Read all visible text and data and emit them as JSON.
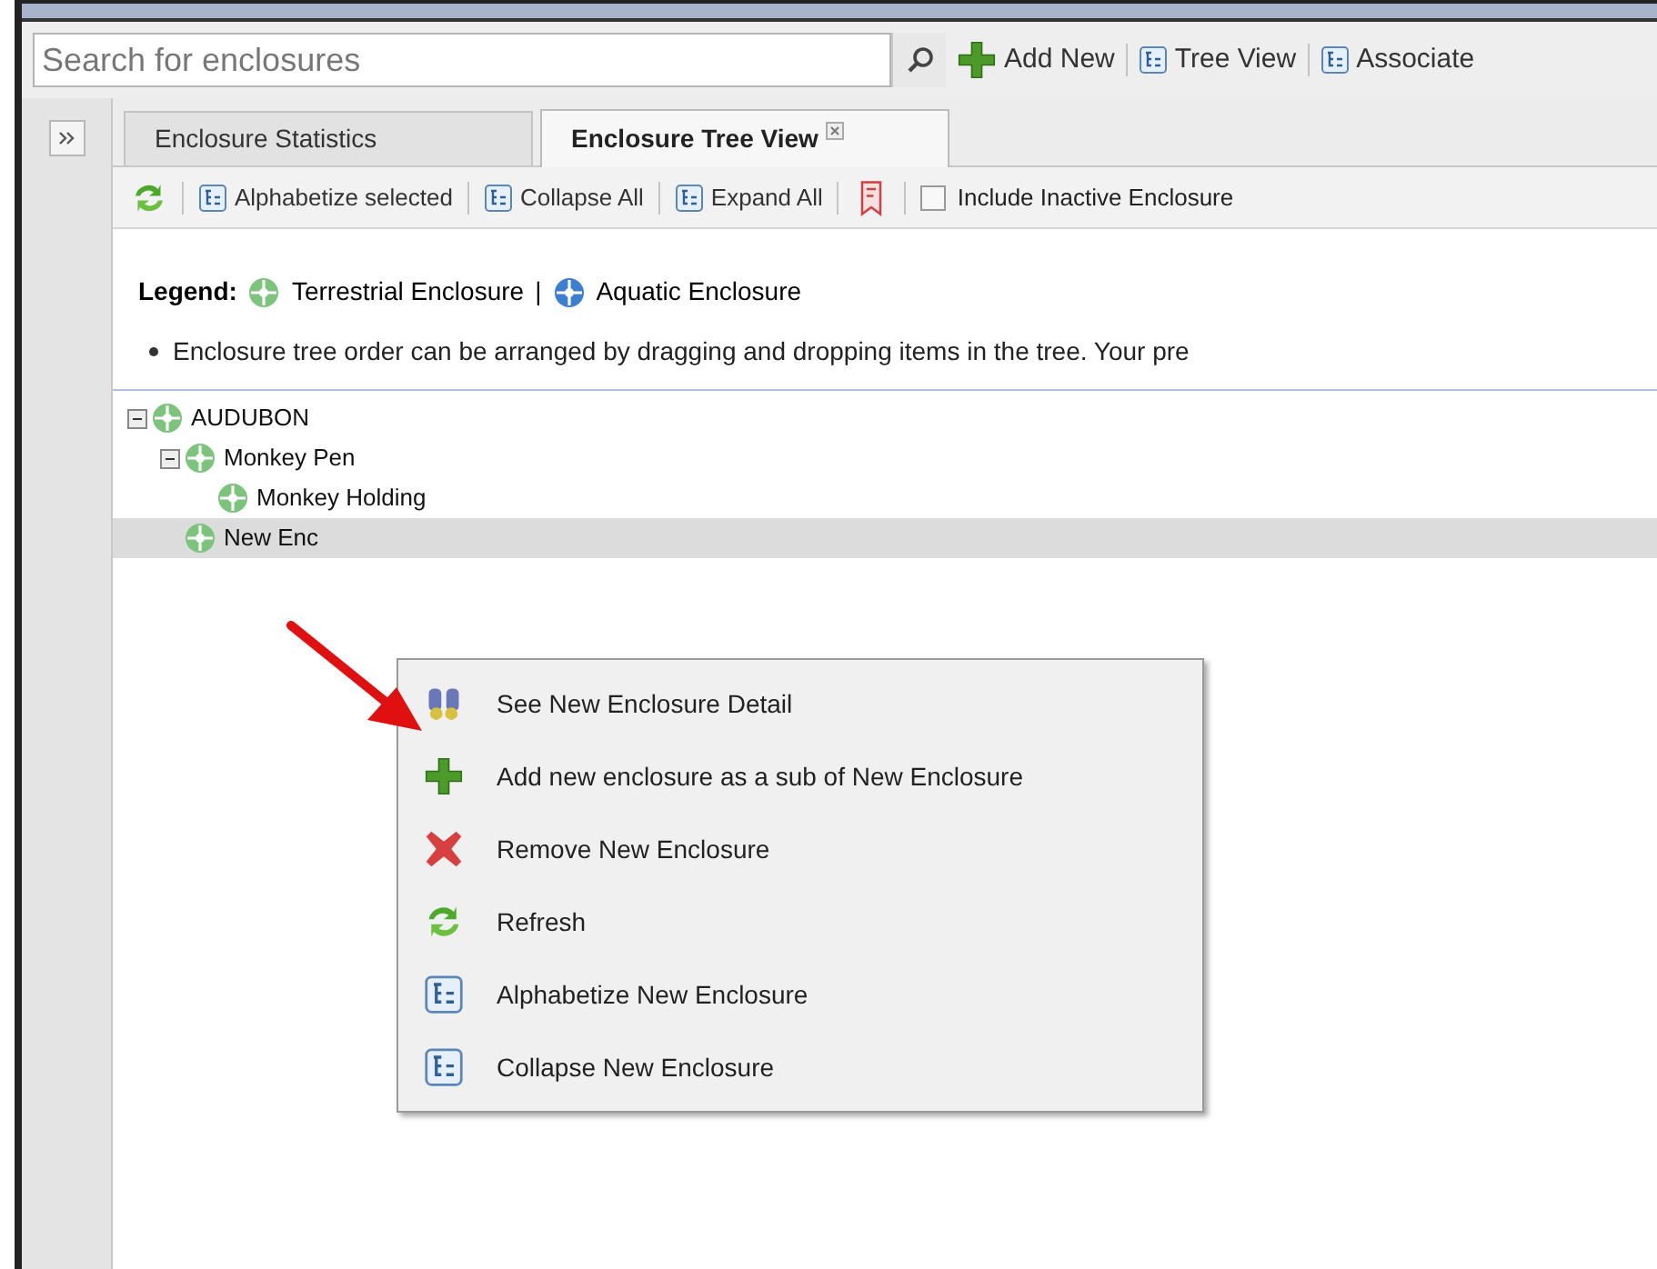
{
  "search": {
    "placeholder": "Search for enclosures"
  },
  "top_toolbar": [
    {
      "kind": "add",
      "label": "Add New"
    },
    {
      "kind": "tree",
      "label": "Tree View"
    },
    {
      "kind": "tree",
      "label": "Associate"
    }
  ],
  "tabs": [
    {
      "label": "Enclosure Statistics",
      "selected": false,
      "closable": false
    },
    {
      "label": "Enclosure Tree View",
      "selected": true,
      "closable": true
    }
  ],
  "tree_toolbar": [
    {
      "kind": "refresh"
    },
    {
      "kind": "tree",
      "label": "Alphabetize selected"
    },
    {
      "kind": "tree",
      "label": "Collapse All"
    },
    {
      "kind": "tree",
      "label": "Expand All"
    },
    {
      "kind": "document"
    },
    {
      "kind": "checkbox",
      "label": "Include Inactive Enclosure",
      "checked": false
    }
  ],
  "legend": {
    "title": "Legend:",
    "items": [
      {
        "label": "Terrestrial Enclosure",
        "color": "#7cc47c"
      },
      {
        "label": "Aquatic Enclosure",
        "color": "#3a7fd0"
      }
    ],
    "separator": "|"
  },
  "notes": [
    "Enclosure tree order can be arranged by dragging and dropping items in the tree. Your pre"
  ],
  "tree": [
    {
      "label": "AUDUBON",
      "expanded": true,
      "selected": false,
      "children": [
        {
          "label": "Monkey Pen",
          "expanded": true,
          "selected": false,
          "children": [
            {
              "label": "Monkey Holding",
              "selected": false
            }
          ]
        },
        {
          "label": "New Enc",
          "selected": true
        }
      ]
    }
  ],
  "context_menu": [
    {
      "kind": "detail",
      "label": "See New Enclosure Detail"
    },
    {
      "kind": "add",
      "label": "Add new enclosure as a sub of New Enclosure"
    },
    {
      "kind": "remove",
      "label": "Remove New Enclosure"
    },
    {
      "kind": "refresh",
      "label": "Refresh"
    },
    {
      "kind": "tree",
      "label": "Alphabetize New Enclosure"
    },
    {
      "kind": "tree",
      "label": "Collapse New Enclosure"
    }
  ]
}
